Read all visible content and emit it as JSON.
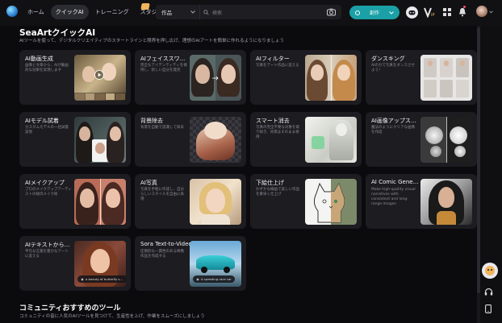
{
  "nav": {
    "items": [
      {
        "label": "ホーム",
        "active": false
      },
      {
        "label": "クイックAI",
        "active": true
      },
      {
        "label": "トレーニング",
        "active": false
      },
      {
        "label": "スタジオ",
        "active": false
      }
    ]
  },
  "search": {
    "select_value": "作品",
    "placeholder": "検索"
  },
  "create_button": {
    "label": "創作"
  },
  "colors": {
    "accent": "#1aa0a6",
    "background": "#0b0b0e",
    "card": "#1c1c21"
  },
  "main": {
    "title": "SeaArtクイックAI",
    "subtitle": "AIツールを使って、デジタルクリエイティブのスタートラインと限界を押し広げ、理想のAIアートを簡単に作れるようになりましょう",
    "cards": [
      {
        "title": "AI動画生成",
        "desc": "画像と文章から、AIが動画的な効果を実現します"
      },
      {
        "title": "AIフェイススワ...",
        "desc": "完全なアイデンティティを保持し、新しい自分を発見"
      },
      {
        "title": "AIフィルター",
        "desc": "写真をアート作品に変える"
      },
      {
        "title": "ダンスキング",
        "desc": "AIの力で写真をダンスさせよう！"
      },
      {
        "title": "AIモデル試着",
        "desc": "カスタムモデルの一括試着実現"
      },
      {
        "title": "背景除去",
        "desc": "背景を自動で認識して除去"
      },
      {
        "title": "スマート消去",
        "desc": "写真の完全不要な対象を取り除き、背景はそのまま保持"
      },
      {
        "title": "AI画像アップス...",
        "desc": "魔法のようにクリアな画像を作成"
      },
      {
        "title": "AIメイクアップ",
        "desc": "プロのメイクアップアーティストの秘伝メイク術"
      },
      {
        "title": "AI写真",
        "desc": "写真を手軽に作成し、自分らしいスタイルを自由に表現"
      },
      {
        "title": "下絵仕上げ",
        "desc": "わずかな線画で美しい作品を素早く仕上げ"
      },
      {
        "title": "AI Comic Gener...",
        "desc": "Make high-quality visual narratives with consistent and long-range images"
      },
      {
        "title": "AIテキストから...",
        "desc": "平凡な言葉を豊かなアートに変える"
      },
      {
        "title": "Sora Text-to-Video",
        "desc": "圧倒的な一貫性のある映像作品を作成する"
      }
    ],
    "pills": {
      "text_to_image": "a beauty of butterfly smiled with freckles",
      "sora": "A speeding race car"
    }
  },
  "section2": {
    "title": "コミュニティおすすめのツール",
    "subtitle": "コミュニティの皆に人気のAIツールを見つけて、生産性を上げ、作業をスムーズにしましょう"
  },
  "icons": [
    "search-icon",
    "camera-icon",
    "discord-icon",
    "vip-icon",
    "grid-icon",
    "bell-icon",
    "headset-icon",
    "phone-icon",
    "chevron-down-icon"
  ]
}
